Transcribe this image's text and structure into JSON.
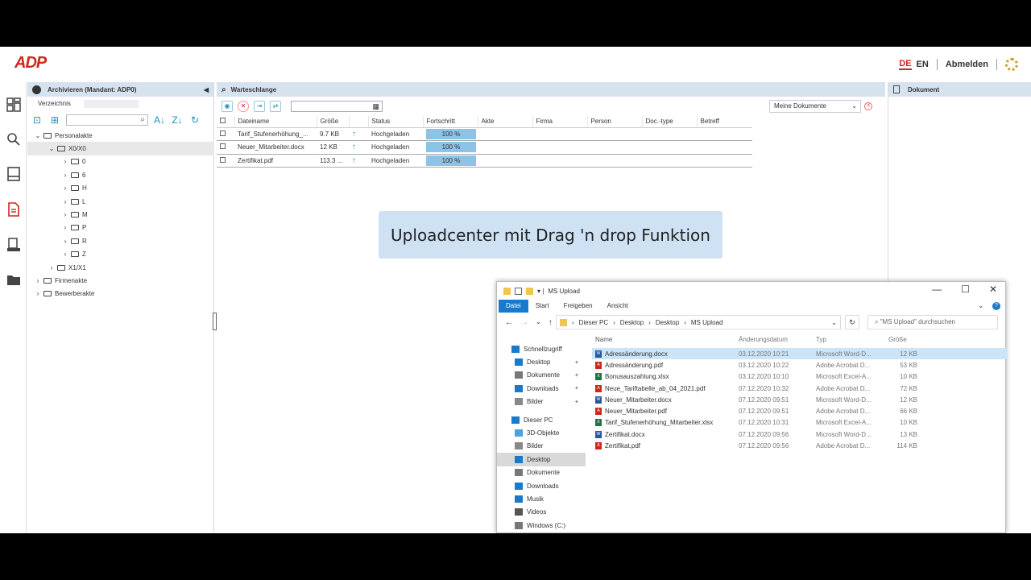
{
  "colors": {
    "accent": "#d0271d",
    "panel_header": "#d6e3ef",
    "progress": "#8ec3e8",
    "upload_ok": "#2aa05b",
    "banner": "#cfe2f3",
    "explorer_blue": "#1979ca"
  },
  "header": {
    "logo": "ADP",
    "lang_de": "DE",
    "lang_en": "EN",
    "logout": "Abmelden"
  },
  "archive": {
    "title": "Archivieren (Mandant: ADP0)",
    "tab_label": "Verzeichnis",
    "search_value": "",
    "tree": [
      {
        "label": "Personalakte",
        "level": 1,
        "expanded": true
      },
      {
        "label": "X0/X0",
        "level": 2,
        "expanded": true,
        "selected": true
      },
      {
        "label": "0",
        "level": 3
      },
      {
        "label": "6",
        "level": 3
      },
      {
        "label": "H",
        "level": 3
      },
      {
        "label": "L",
        "level": 3
      },
      {
        "label": "M",
        "level": 3
      },
      {
        "label": "P",
        "level": 3
      },
      {
        "label": "R",
        "level": 3
      },
      {
        "label": "Z",
        "level": 3
      },
      {
        "label": "X1/X1",
        "level": 2
      },
      {
        "label": "Firmenakte",
        "level": 1
      },
      {
        "label": "Bewerberakte",
        "level": 1
      }
    ]
  },
  "queue": {
    "title": "Warteschlange",
    "filter_select": "Meine Dokumente",
    "columns": [
      "Dateiname",
      "Größe",
      "",
      "Status",
      "Fortschritt",
      "Akte",
      "Firma",
      "Person",
      "Doc.-type",
      "Betreff"
    ],
    "rows": [
      {
        "name": "Tarif_Stufenerhöhung_...",
        "size": "9.7 KB",
        "status": "Hochgeladen",
        "progress": "100 %"
      },
      {
        "name": "Neuer_Mitarbeiter.docx",
        "size": "12 KB",
        "status": "Hochgeladen",
        "progress": "100 %"
      },
      {
        "name": "Zertifikat.pdf",
        "size": "113.3 ...",
        "status": "Hochgeladen",
        "progress": "100 %"
      }
    ]
  },
  "banner": {
    "text": "Uploadcenter mit Drag 'n drop Funktion"
  },
  "document": {
    "title": "Dokument"
  },
  "explorer": {
    "title": "MS Upload",
    "ribbon": [
      "Datei",
      "Start",
      "Freigeben",
      "Ansicht"
    ],
    "path": [
      "Dieser PC",
      "Desktop",
      "Desktop",
      "MS Upload"
    ],
    "search_placeholder": "\"MS Upload\" durchsuchen",
    "sidebar": [
      {
        "label": "Schnellzugriff",
        "top": true,
        "icon": "star-icon"
      },
      {
        "label": "Desktop",
        "pinned": true,
        "icon": "desktop-icon"
      },
      {
        "label": "Dokumente",
        "pinned": true,
        "icon": "documents-icon"
      },
      {
        "label": "Downloads",
        "pinned": true,
        "icon": "download-icon"
      },
      {
        "label": "Bilder",
        "pinned": true,
        "icon": "pictures-icon"
      },
      {
        "label": "Dieser PC",
        "top": true,
        "icon": "pc-icon"
      },
      {
        "label": "3D-Objekte",
        "icon": "cube-icon"
      },
      {
        "label": "Bilder",
        "icon": "pictures-icon"
      },
      {
        "label": "Desktop",
        "icon": "desktop-icon",
        "selected": true
      },
      {
        "label": "Dokumente",
        "icon": "documents-icon"
      },
      {
        "label": "Downloads",
        "icon": "download-icon"
      },
      {
        "label": "Musik",
        "icon": "music-icon"
      },
      {
        "label": "Videos",
        "icon": "video-icon"
      },
      {
        "label": "Windows (C:)",
        "icon": "drive-icon"
      }
    ],
    "columns": [
      "Name",
      "Änderungsdatum",
      "Typ",
      "Größe"
    ],
    "files": [
      {
        "name": "Adressänderung.docx",
        "date": "03.12.2020 10:21",
        "type": "Microsoft Word-D...",
        "size": "12 KB",
        "kind": "docx"
      },
      {
        "name": "Adressänderung.pdf",
        "date": "03.12.2020 10:22",
        "type": "Adobe Acrobat D...",
        "size": "53 KB",
        "kind": "pdf"
      },
      {
        "name": "Bonusauszahlung.xlsx",
        "date": "03.12.2020 10:10",
        "type": "Microsoft Excel-A...",
        "size": "10 KB",
        "kind": "xlsx"
      },
      {
        "name": "Neue_Tariftabelle_ab_04_2021.pdf",
        "date": "07.12.2020 10:32",
        "type": "Adobe Acrobat D...",
        "size": "72 KB",
        "kind": "pdf"
      },
      {
        "name": "Neuer_Mitarbeiter.docx",
        "date": "07.12.2020 09:51",
        "type": "Microsoft Word-D...",
        "size": "12 KB",
        "kind": "docx"
      },
      {
        "name": "Neuer_Mitarbeiter.pdf",
        "date": "07.12.2020 09:51",
        "type": "Adobe Acrobat D...",
        "size": "66 KB",
        "kind": "pdf"
      },
      {
        "name": "Tarif_Stufenerhöhung_Mitarbeiter.xlsx",
        "date": "07.12.2020 10:31",
        "type": "Microsoft Excel-A...",
        "size": "10 KB",
        "kind": "xlsx"
      },
      {
        "name": "Zertifikat.docx",
        "date": "07.12.2020 09:56",
        "type": "Microsoft Word-D...",
        "size": "13 KB",
        "kind": "docx"
      },
      {
        "name": "Zertifikat.pdf",
        "date": "07.12.2020 09:56",
        "type": "Adobe Acrobat D...",
        "size": "114 KB",
        "kind": "pdf"
      }
    ]
  }
}
